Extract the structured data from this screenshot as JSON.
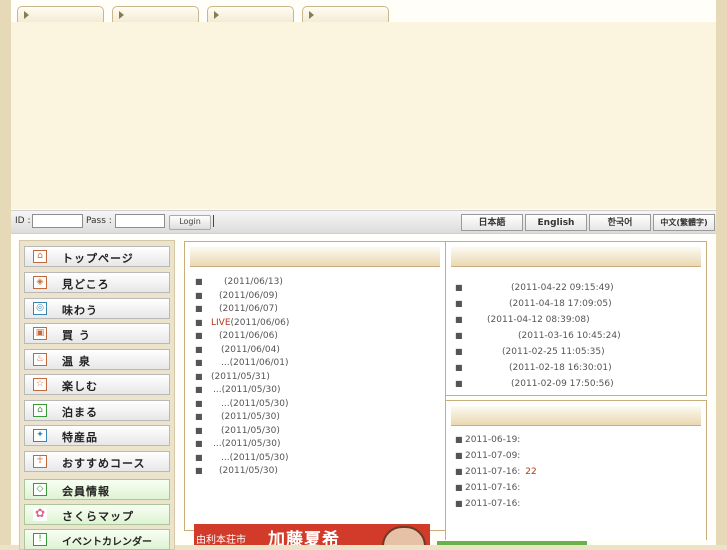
{
  "top_tabs": [
    "",
    "",
    "",
    ""
  ],
  "login": {
    "id_label": "ID :",
    "pass_label": "Pass :",
    "login_button": "Login",
    "id_value": "",
    "pass_value": ""
  },
  "languages": [
    "日本語",
    "English",
    "한국어",
    "中文(繁體字)"
  ],
  "menu": [
    {
      "label": "トップページ",
      "icon": "home-icon"
    },
    {
      "label": "見どころ",
      "icon": "sights-icon"
    },
    {
      "label": "味わう",
      "icon": "food-icon"
    },
    {
      "label": "買 う",
      "icon": "shopping-icon"
    },
    {
      "label": "温 泉",
      "icon": "hot-spring-icon"
    },
    {
      "label": "楽しむ",
      "icon": "enjoy-icon"
    },
    {
      "label": "泊まる",
      "icon": "lodging-icon"
    },
    {
      "label": "特産品",
      "icon": "specialty-icon"
    },
    {
      "label": "おすすめコース",
      "icon": "course-icon"
    },
    {
      "label": "会員情報",
      "icon": "member-icon"
    },
    {
      "label": "さくらマップ",
      "icon": "sakura-icon"
    },
    {
      "label": "イベントカレンダー",
      "icon": "calendar-icon"
    }
  ],
  "news": [
    {
      "prefix": "",
      "date": "(2011/06/13)"
    },
    {
      "prefix": "",
      "date": "(2011/06/09)"
    },
    {
      "prefix": "",
      "date": "(2011/06/07)"
    },
    {
      "prefix": "LIVE",
      "date": "(2011/06/06)"
    },
    {
      "prefix": "",
      "date": "(2011/06/06)"
    },
    {
      "prefix": "",
      "date": "(2011/06/04)"
    },
    {
      "prefix": "",
      "date": "...(2011/06/01)"
    },
    {
      "prefix": "",
      "date": "(2011/05/31)"
    },
    {
      "prefix": "",
      "date": "...(2011/05/30)"
    },
    {
      "prefix": "",
      "date": "...(2011/05/30)"
    },
    {
      "prefix": "",
      "date": "(2011/05/30)"
    },
    {
      "prefix": "",
      "date": "(2011/05/30)"
    },
    {
      "prefix": "",
      "date": "...(2011/05/30)"
    },
    {
      "prefix": "",
      "date": "...(2011/05/30)"
    },
    {
      "prefix": "",
      "date": "(2011/05/30)"
    }
  ],
  "updates": [
    "(2011-04-22 09:15:49)",
    "(2011-04-18 17:09:05)",
    "(2011-04-12 08:39:08)",
    "(2011-03-16 10:45:24)",
    "(2011-02-25 11:05:35)",
    "(2011-02-18 16:30:01)",
    "(2011-02-09 17:50:56)"
  ],
  "events": [
    {
      "date": "2011-06-19:",
      "note": ""
    },
    {
      "date": "2011-07-09:",
      "note": ""
    },
    {
      "date": "2011-07-16:",
      "note": "22"
    },
    {
      "date": "2011-07-16:",
      "note": ""
    },
    {
      "date": "2011-07-16:",
      "note": ""
    }
  ],
  "ad": {
    "main": "加藤夏希",
    "small": "由利本荘市"
  }
}
